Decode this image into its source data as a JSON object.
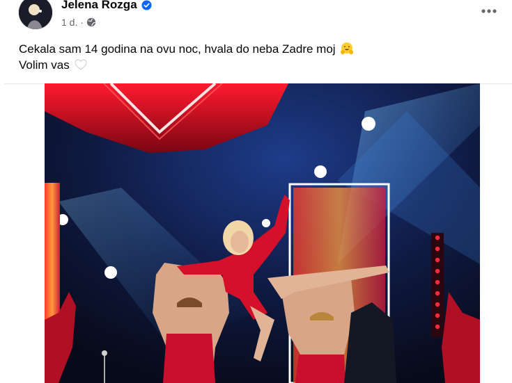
{
  "post": {
    "author_name": "Jelena Rozga",
    "timestamp": "1 d.",
    "separator": "·",
    "privacy_icon": "globe-icon",
    "verified_icon": "verified-badge-icon",
    "more_icon": "more-options-icon",
    "caption_line1": "Cekala sam 14 godina na ovu noc, hvala do neba Zadre moj",
    "caption_line1_emoji": "smiling-face-with-open-hands-emoji",
    "caption_line2": "Volim vas",
    "caption_line2_emoji": "white-heart-emoji",
    "photo_subject": "stage-performance-photo"
  },
  "colors": {
    "text_primary": "#050505",
    "text_secondary": "#65676b",
    "verified_blue": "#0866ff",
    "divider": "#e4e6eb",
    "stage_red": "#e0162b"
  }
}
